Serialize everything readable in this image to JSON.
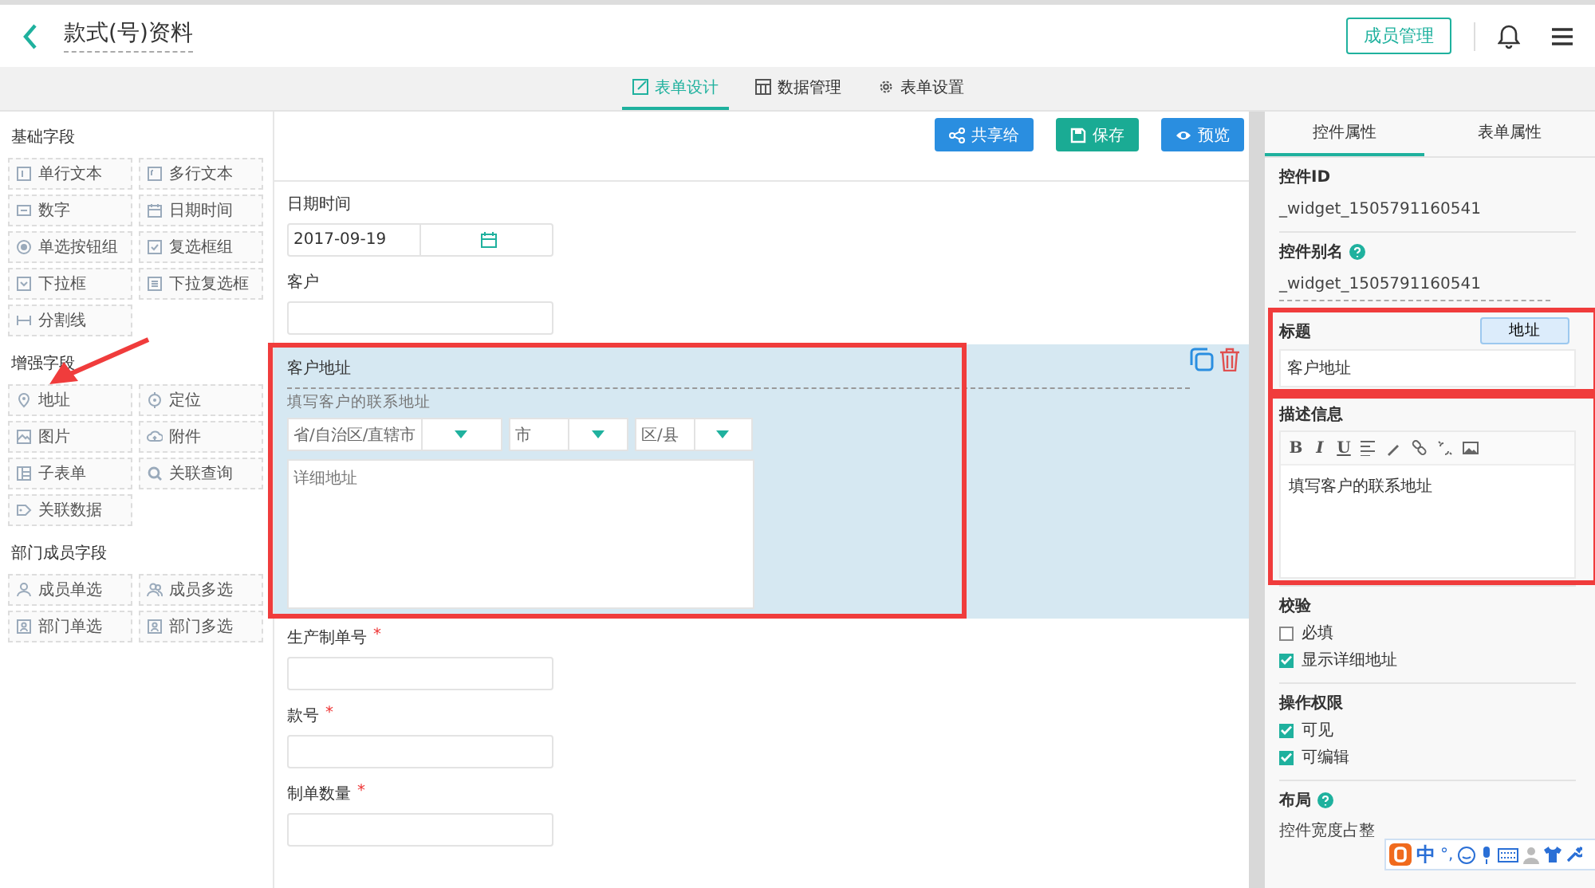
{
  "header": {
    "title": "款式(号)资料",
    "member_button": "成员管理"
  },
  "tabs": [
    {
      "label": "表单设计",
      "selected": true
    },
    {
      "label": "数据管理",
      "selected": false
    },
    {
      "label": "表单设置",
      "selected": false
    }
  ],
  "palette": {
    "groups": [
      {
        "title": "基础字段",
        "items": [
          {
            "label": "单行文本",
            "pointed": false
          },
          {
            "label": "多行文本",
            "pointed": false
          },
          {
            "label": "数字",
            "pointed": false
          },
          {
            "label": "日期时间",
            "pointed": false
          },
          {
            "label": "单选按钮组",
            "pointed": false
          },
          {
            "label": "复选框组",
            "pointed": false
          },
          {
            "label": "下拉框",
            "pointed": false
          },
          {
            "label": "下拉复选框",
            "pointed": false
          },
          {
            "label": "分割线",
            "pointed": false
          }
        ]
      },
      {
        "title": "增强字段",
        "items": [
          {
            "label": "地址",
            "pointed": true
          },
          {
            "label": "定位",
            "pointed": false
          },
          {
            "label": "图片",
            "pointed": false
          },
          {
            "label": "附件",
            "pointed": false
          },
          {
            "label": "子表单",
            "pointed": false
          },
          {
            "label": "关联查询",
            "pointed": false
          },
          {
            "label": "关联数据",
            "pointed": false
          }
        ]
      },
      {
        "title": "部门成员字段",
        "items": [
          {
            "label": "成员单选",
            "pointed": false
          },
          {
            "label": "成员多选",
            "pointed": false
          },
          {
            "label": "部门单选",
            "pointed": false
          },
          {
            "label": "部门多选",
            "pointed": false
          }
        ]
      }
    ]
  },
  "toolbar": {
    "buttons": [
      {
        "label": "共享给",
        "kind": "share"
      },
      {
        "label": "保存",
        "kind": "save"
      },
      {
        "label": "预览",
        "kind": "preview"
      }
    ]
  },
  "form": {
    "fields": [
      {
        "label": "日期时间",
        "kind": "date",
        "value": "2017-09-19",
        "selected": false,
        "highlighted": false
      },
      {
        "label": "客户",
        "kind": "text",
        "selected": false,
        "highlighted": false
      },
      {
        "label": "客户地址",
        "kind": "address",
        "description": "填写客户的联系地址",
        "selects": [
          "省/自治区/直辖市",
          "市",
          "区/县"
        ],
        "detail_placeholder": "详细地址",
        "selected": true,
        "highlighted": true
      },
      {
        "label": "生产制单号",
        "kind": "text",
        "required_mark": "*",
        "selected": false,
        "highlighted": false
      },
      {
        "label": "款号",
        "kind": "text",
        "required_mark": "*",
        "selected": false,
        "highlighted": false
      },
      {
        "label": "制单数量",
        "kind": "text",
        "required_mark": "*",
        "selected": false,
        "highlighted": false
      }
    ]
  },
  "properties": {
    "tabs": [
      {
        "label": "控件属性",
        "selected": true
      },
      {
        "label": "表单属性",
        "selected": false
      }
    ],
    "sections": [
      {
        "kind": "text",
        "title": "控件ID",
        "value": "_widget_1505791160541",
        "highlighted": false
      },
      {
        "kind": "alias",
        "title": "控件别名",
        "value": "_widget_1505791160541",
        "highlighted": false
      },
      {
        "kind": "title",
        "title": "标题",
        "button": "地址",
        "value": "客户地址",
        "highlighted": true
      },
      {
        "kind": "editor",
        "title": "描述信息",
        "format_buttons": [
          "B",
          "I",
          "U"
        ],
        "value": "填写客户的联系地址",
        "highlighted": true
      },
      {
        "kind": "checks",
        "title": "校验",
        "options": [
          {
            "label": "必填",
            "checked": false
          },
          {
            "label": "显示详细地址",
            "checked": true
          }
        ],
        "highlighted": false
      },
      {
        "kind": "checks",
        "title": "操作权限",
        "options": [
          {
            "label": "可见",
            "checked": true
          },
          {
            "label": "可编辑",
            "checked": true
          }
        ],
        "highlighted": false
      },
      {
        "kind": "layout",
        "title": "布局",
        "value": "控件宽度占整",
        "highlighted": false
      }
    ]
  },
  "ime": {
    "mode": "中",
    "punctuation": "°,"
  }
}
